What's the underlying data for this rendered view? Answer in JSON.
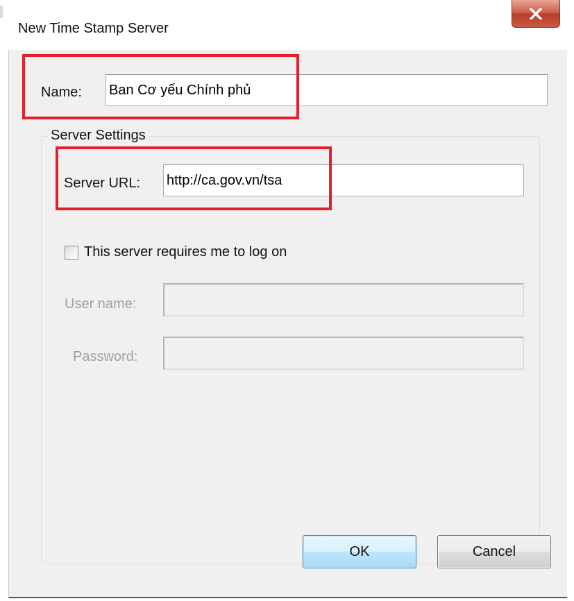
{
  "window": {
    "title": "New Time Stamp Server",
    "close_icon": "close-x-icon"
  },
  "form": {
    "name_label": "Name:",
    "name_value": "Ban Cơ yếu Chính phủ",
    "group_title": "Server Settings",
    "server_url_label": "Server URL:",
    "server_url_value": "http://ca.gov.vn/tsa",
    "logon_checkbox_label": "This server requires me to log on",
    "logon_checked": false,
    "username_label": "User name:",
    "username_value": "",
    "password_label": "Password:",
    "password_value": ""
  },
  "buttons": {
    "ok_label": "OK",
    "cancel_label": "Cancel"
  },
  "colors": {
    "highlight": "#e0202c",
    "dialog_bg": "#f0f0f0",
    "ok_button_border": "#3c7fb1"
  }
}
